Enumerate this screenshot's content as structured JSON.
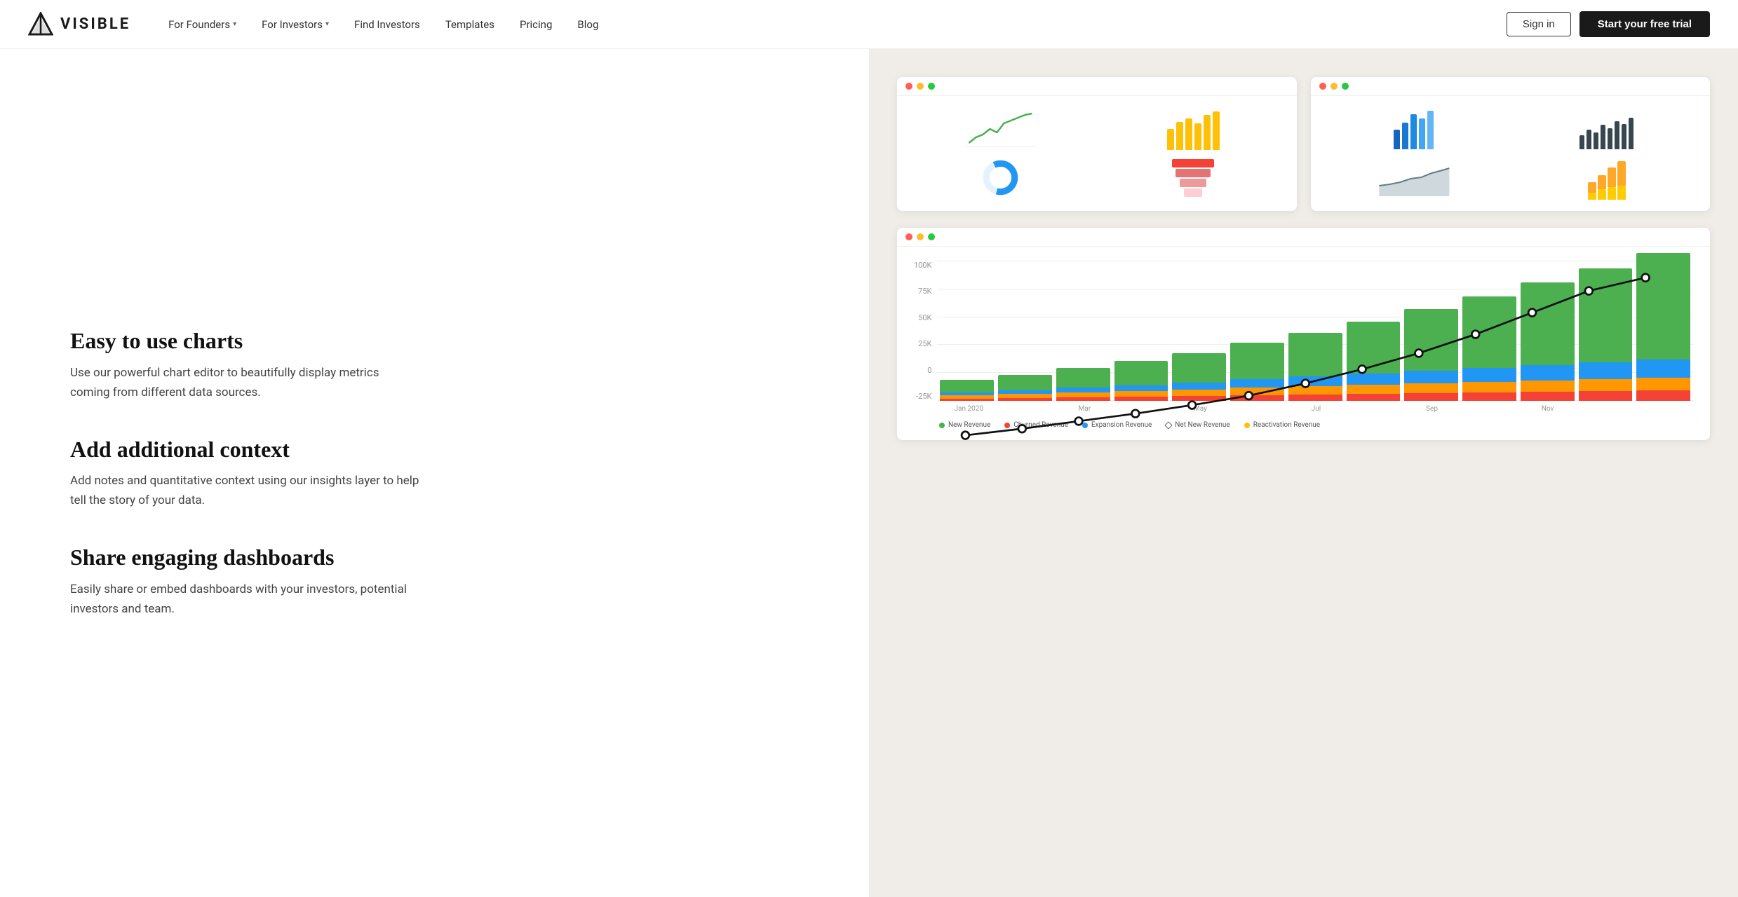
{
  "nav": {
    "logo_text": "VISIBLE",
    "links": [
      {
        "label": "For Founders",
        "has_chevron": true
      },
      {
        "label": "For Investors",
        "has_chevron": true
      },
      {
        "label": "Find Investors",
        "has_chevron": false
      },
      {
        "label": "Templates",
        "has_chevron": false
      },
      {
        "label": "Pricing",
        "has_chevron": false
      },
      {
        "label": "Blog",
        "has_chevron": false
      }
    ],
    "signin_label": "Sign in",
    "trial_label": "Start your free trial"
  },
  "features": [
    {
      "title": "Easy to use charts",
      "desc": "Use our powerful chart editor to beautifully display metrics coming from different data sources."
    },
    {
      "title": "Add additional context",
      "desc": "Add notes and quantitative context using our insights layer to help tell the story of your data."
    },
    {
      "title": "Share engaging dashboards",
      "desc": "Easily share or embed dashboards with your investors, potential investors and team."
    }
  ],
  "chart_large": {
    "y_labels": [
      "100K",
      "75K",
      "50K",
      "25K",
      "0",
      "-25K"
    ],
    "x_labels": [
      "Jan 2020",
      "Mar",
      "May",
      "Jul",
      "Sep",
      "Nov"
    ],
    "legend": [
      {
        "label": "New Revenue",
        "color": "#4caf50",
        "type": "dot"
      },
      {
        "label": "Churned Revenue",
        "color": "#f44336",
        "type": "dot"
      },
      {
        "label": "Expansion Revenue",
        "color": "#2196f3",
        "type": "dot"
      },
      {
        "label": "Net New Revenue",
        "color": "#666",
        "type": "diamond"
      },
      {
        "label": "Reactivation Revenue",
        "color": "#ffc107",
        "type": "dot"
      }
    ]
  },
  "colors": {
    "accent_green": "#4caf50",
    "accent_blue": "#2196f3",
    "accent_orange": "#ff9800",
    "accent_yellow": "#ffc107",
    "accent_red": "#f44336",
    "bar_green": "#43a047",
    "bar_blue": "#1e88e5",
    "bar_dark": "#263238"
  }
}
